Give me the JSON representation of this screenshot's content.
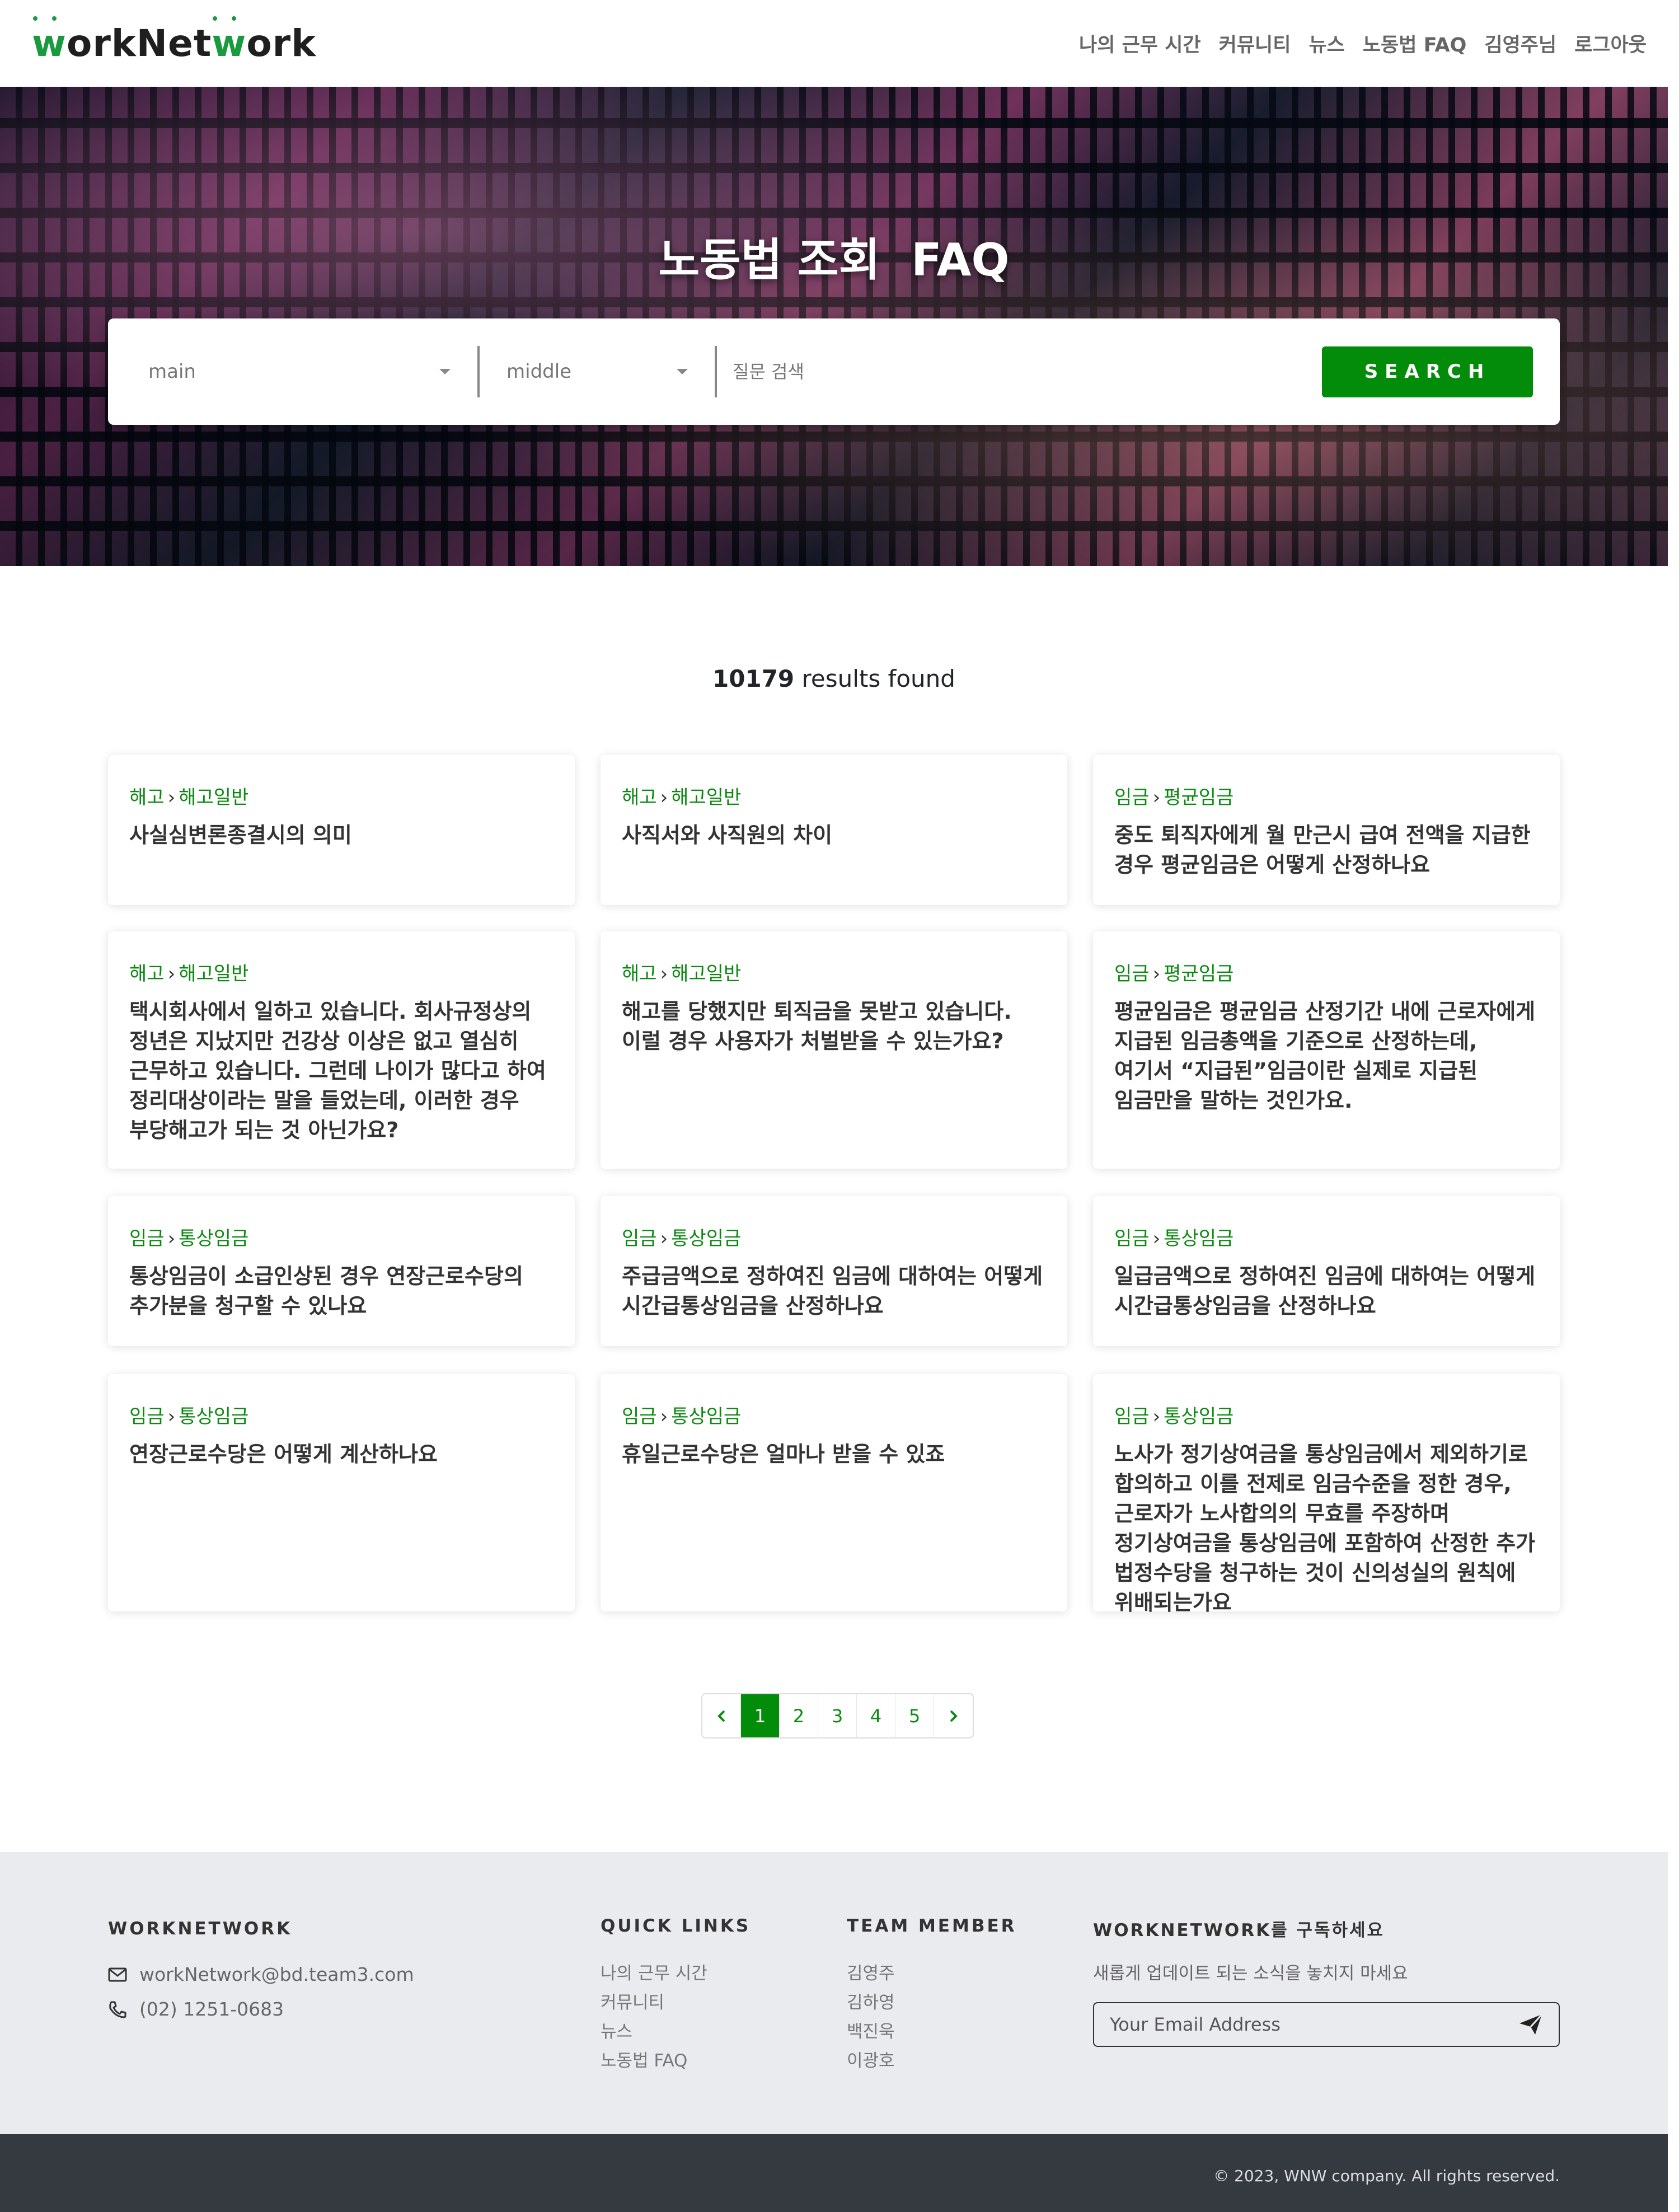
{
  "navbar": {
    "brand": "workNetwork",
    "links": [
      "나의 근무 시간",
      "커뮤니티",
      "뉴스",
      "노동법 FAQ",
      "김영주님",
      "로그아웃"
    ]
  },
  "hero": {
    "title": "노동법 조회  FAQ",
    "select_main": "main",
    "select_middle": "middle",
    "search_placeholder": "질문 검색",
    "search_button": "SEARCH"
  },
  "results": {
    "count": "10179",
    "suffix": " results found"
  },
  "cards": [
    {
      "main": "해고",
      "sub": "해고일반",
      "title": "사실심변론종결시의 의미"
    },
    {
      "main": "해고",
      "sub": "해고일반",
      "title": "사직서와 사직원의 차이"
    },
    {
      "main": "임금",
      "sub": "평균임금",
      "title": "중도 퇴직자에게 월 만근시 급여 전액을 지급한 경우 평균임금은 어떻게 산정하나요"
    },
    {
      "main": "해고",
      "sub": "해고일반",
      "title": "택시회사에서 일하고 있습니다. 회사규정상의 정년은 지났지만 건강상 이상은 없고 열심히 근무하고 있습니다. 그런데 나이가 많다고 하여 정리대상이라는 말을 들었는데, 이러한 경우 부당해고가 되는 것 아닌가요?"
    },
    {
      "main": "해고",
      "sub": "해고일반",
      "title": "해고를 당했지만 퇴직금을 못받고 있습니다. 이럴 경우 사용자가 처벌받을 수 있는가요?"
    },
    {
      "main": "임금",
      "sub": "평균임금",
      "title": "평균임금은 평균임금 산정기간 내에 근로자에게 지급된 임금총액을 기준으로 산정하는데, 여기서 “지급된”임금이란 실제로 지급된 임금만을 말하는 것인가요."
    },
    {
      "main": "임금",
      "sub": "통상임금",
      "title": "통상임금이 소급인상된 경우 연장근로수당의 추가분을 청구할 수 있나요"
    },
    {
      "main": "임금",
      "sub": "통상임금",
      "title": "주급금액으로 정하여진 임금에 대하여는 어떻게 시간급통상임금을 산정하나요"
    },
    {
      "main": "임금",
      "sub": "통상임금",
      "title": "일급금액으로 정하여진 임금에 대하여는 어떻게 시간급통상임금을 산정하나요"
    },
    {
      "main": "임금",
      "sub": "통상임금",
      "title": "연장근로수당은 어떻게 계산하나요"
    },
    {
      "main": "임금",
      "sub": "통상임금",
      "title": "휴일근로수당은 얼마나 받을 수 있죠"
    },
    {
      "main": "임금",
      "sub": "통상임금",
      "title": "노사가 정기상여금을 통상임금에서 제외하기로 합의하고 이를 전제로 임금수준을 정한 경우, 근로자가 노사합의의 무효를 주장하며 정기상여금을 통상임금에 포함하여 산정한 추가 법정수당을 청구하는 것이 신의성실의 원칙에 위배되는가요"
    }
  ],
  "pagination": {
    "prev_icon": "chevron-left-icon",
    "pages": [
      "1",
      "2",
      "3",
      "4",
      "5"
    ],
    "active": "1",
    "next_icon": "chevron-right-icon"
  },
  "footer": {
    "brand_heading": "WORKNETWORK",
    "email": "workNetwork@bd.team3.com",
    "phone": "(02) 1251-0683",
    "quick_links_heading": "QUICK LINKS",
    "quick_links": [
      "나의 근무 시간",
      "커뮤니티",
      "뉴스",
      "노동법 FAQ"
    ],
    "team_heading": "TEAM MEMBER",
    "team": [
      "김영주",
      "김하영",
      "백진욱",
      "이광호"
    ],
    "subscribe_heading": "WORKNETWORK를 구독하세요",
    "subscribe_text": "새롭게 업데이트 되는 소식을 놓치지 마세요",
    "subscribe_placeholder": "Your Email Address",
    "copyright": "© 2023, WNW company. All rights reserved."
  },
  "colors": {
    "accent_green": "#038c0a",
    "crumb_green": "#0a8a0f",
    "footer_bg": "#e9ebee",
    "bottom_bar": "#343a40"
  }
}
